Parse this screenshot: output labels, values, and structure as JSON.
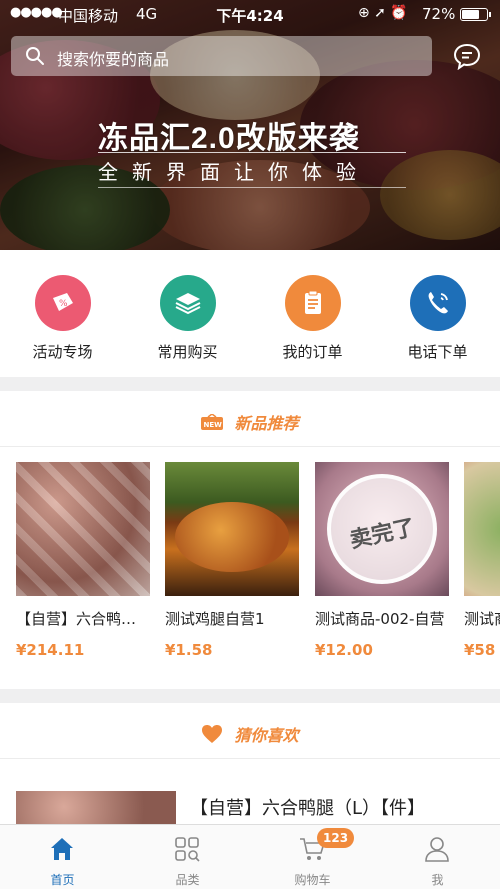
{
  "status_bar": {
    "signal": "●●●●●",
    "carrier": "中国移动",
    "network": "4G",
    "time": "下午4:24",
    "battery_text": "72%",
    "battery_level": 0.72
  },
  "search": {
    "placeholder": "搜索你要的商品"
  },
  "banner": {
    "headline": "冻品汇2.0改版来袭",
    "subline": "全新界面让你体验"
  },
  "quick_actions": [
    {
      "label": "活动专场",
      "icon": "activity-icon",
      "color": "#ec5a72"
    },
    {
      "label": "常用购买",
      "icon": "stack-icon",
      "color": "#27a98b"
    },
    {
      "label": "我的订单",
      "icon": "order-icon",
      "color": "#f08a3c"
    },
    {
      "label": "电话下单",
      "icon": "phone-icon",
      "color": "#1e6fb8"
    }
  ],
  "new_products": {
    "title": "新品推荐",
    "badge": "NEW",
    "items": [
      {
        "name": "【自营】六合鸭腿（L）【件】",
        "price": "¥214.11"
      },
      {
        "name": "测试鸡腿自营1",
        "price": "¥1.58"
      },
      {
        "name": "测试商品-002-自营",
        "price": "¥12.00",
        "sold_out": "卖完了"
      },
      {
        "name": "测试商品",
        "price": "¥58"
      }
    ]
  },
  "guess_like": {
    "title": "猜你喜欢",
    "first_item_name": "【自营】六合鸭腿（L）【件】"
  },
  "tab_bar": {
    "items": [
      {
        "label": "首页",
        "icon": "home-icon",
        "active": true
      },
      {
        "label": "品类",
        "icon": "category-icon",
        "active": false
      },
      {
        "label": "购物车",
        "icon": "cart-icon",
        "active": false
      },
      {
        "label": "我",
        "icon": "user-icon",
        "active": false
      }
    ],
    "cart_badge": "123"
  },
  "colors": {
    "accent": "#f08a3c",
    "primary": "#1e6fb8"
  }
}
